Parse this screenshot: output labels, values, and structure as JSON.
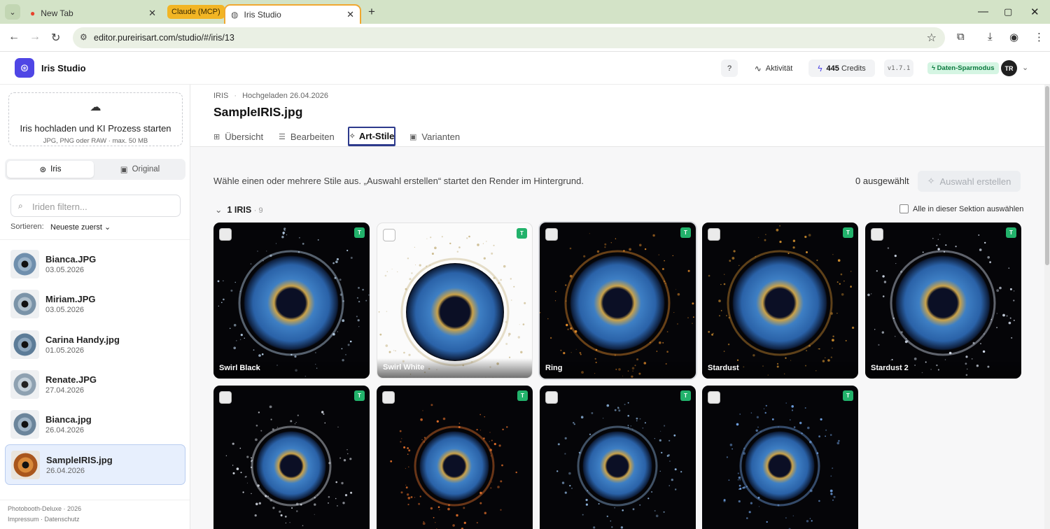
{
  "browser": {
    "tabs": [
      {
        "title": "New Tab"
      },
      {
        "group_label": "Claude (MCP)"
      },
      {
        "title": "Iris Studio"
      }
    ],
    "url": "editor.pureirisart.com/studio/#/iris/13",
    "new_tab_symbol": "+"
  },
  "header": {
    "app_name": "Iris Studio",
    "activity_label": "Aktivität",
    "credits_value": "445",
    "credits_label": "Credits",
    "version": "v1.7.1",
    "saver_label": "Daten-Sparmodus",
    "avatar_initials": "TR"
  },
  "sidebar": {
    "upload_title": "Iris hochladen und KI Prozess starten",
    "upload_hint": "JPG, PNG oder RAW · max. 50 MB",
    "view_toggle": [
      "Iris",
      "Original"
    ],
    "filter_placeholder": "Iriden filtern...",
    "sort_label": "Sortieren:",
    "sort_value": "Neueste zuerst",
    "files": [
      {
        "name": "Bianca.JPG",
        "date": "03.05.2026"
      },
      {
        "name": "Miriam.JPG",
        "date": "03.05.2026"
      },
      {
        "name": "Carina Handy.jpg",
        "date": "01.05.2026"
      },
      {
        "name": "Renate.JPG",
        "date": "27.04.2026"
      },
      {
        "name": "Bianca.jpg",
        "date": "26.04.2026"
      },
      {
        "name": "SampleIRIS.jpg",
        "date": "26.04.2026"
      }
    ],
    "footer_brand": "Photobooth-Deluxe · 2026",
    "footer_links": "Impressum · Datenschutz"
  },
  "main": {
    "breadcrumb_type": "IRIS",
    "breadcrumb_uploaded": "Hochgeladen 26.04.2026",
    "title": "SampleIRIS.jpg",
    "tabs": [
      "Übersicht",
      "Bearbeiten",
      "Art-Stile",
      "Varianten"
    ],
    "active_tab": "Art-Stile",
    "hint": "Wähle einen oder mehrere Stile aus. „Auswahl erstellen“ startet den Render im Hintergrund.",
    "selected_count": "0 ausgewählt",
    "create_button": "Auswahl erstellen",
    "section_title": "1 IRIS",
    "section_count": "· 9",
    "select_all_label": "Alle in dieser Sektion auswählen",
    "badge_letter": "T",
    "styles": [
      {
        "label": "Swirl Black",
        "bg": "#050508",
        "accent": "#b8d0e8"
      },
      {
        "label": "Swirl White",
        "bg": "#fbfbfb",
        "accent": "#c9b88a"
      },
      {
        "label": "Ring",
        "bg": "#050508",
        "accent": "#e08a2a"
      },
      {
        "label": "Stardust",
        "bg": "#050508",
        "accent": "#c98a2e"
      },
      {
        "label": "Stardust 2",
        "bg": "#050508",
        "accent": "#cfd8e6"
      },
      {
        "label": "",
        "bg": "#050508",
        "accent": "#d8dde6"
      },
      {
        "label": "",
        "bg": "#050508",
        "accent": "#e3702a"
      },
      {
        "label": "",
        "bg": "#050508",
        "accent": "#8ab0d8"
      },
      {
        "label": "",
        "bg": "#050508",
        "accent": "#6fa0e0"
      }
    ]
  },
  "colors": {
    "accent": "#4f46e5",
    "tab_underline": "#2d3a8c",
    "badge": "#22b26b",
    "selected_row": "#e7effd"
  },
  "icons": [
    "chevron-down-icon",
    "close-icon",
    "globe-icon",
    "back-icon",
    "forward-icon",
    "reload-icon",
    "site-info-icon",
    "star-icon",
    "extensions-icon",
    "download-icon",
    "profile-icon",
    "menu-icon",
    "help-icon",
    "activity-icon",
    "lightning-icon",
    "upload-cloud-icon",
    "iris-icon",
    "image-icon",
    "search-icon",
    "grid-icon",
    "sliders-icon",
    "sparkle-icon"
  ]
}
